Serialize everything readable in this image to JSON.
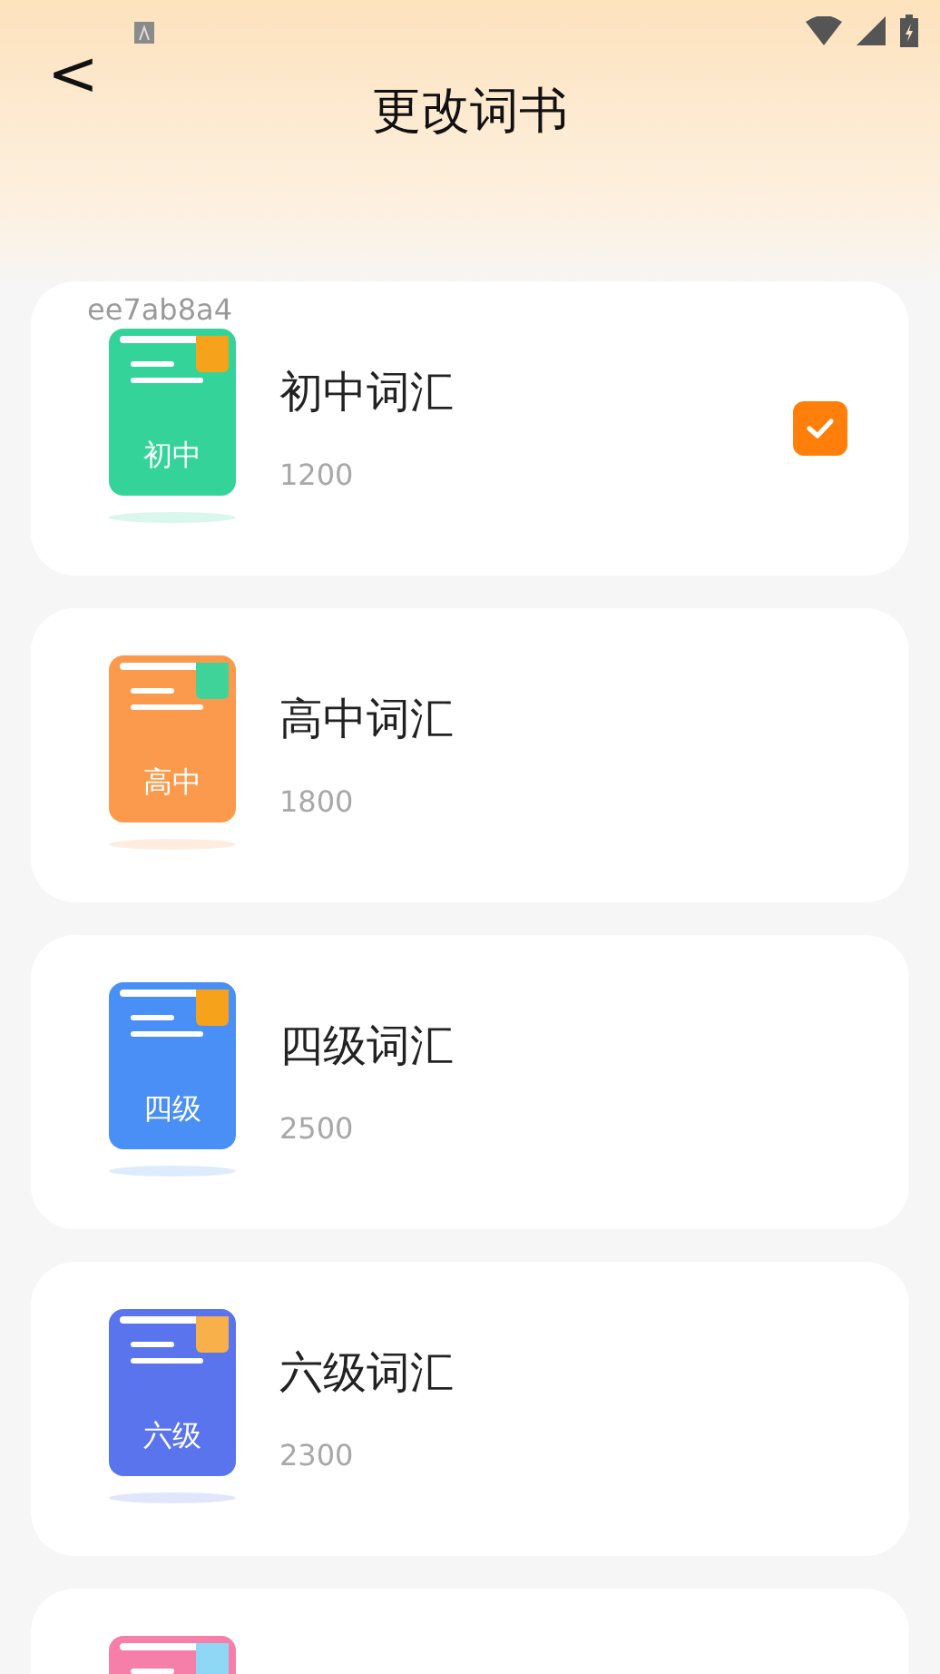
{
  "header": {
    "back": "<",
    "title": "更改词书"
  },
  "debug_label": "ee7ab8a4",
  "books": [
    {
      "title": "初中词汇",
      "count": "1200",
      "cover_label": "初中",
      "color": "#34d39a",
      "bookmark": {
        "color": "#f7a21b"
      },
      "checked": true
    },
    {
      "title": "高中词汇",
      "count": "1800",
      "cover_label": "高中",
      "color": "#fb9a4c",
      "bookmark": {
        "color": "#3fd39a"
      },
      "checked": false
    },
    {
      "title": "四级词汇",
      "count": "2500",
      "cover_label": "四级",
      "color": "#4a8ff5",
      "bookmark": {
        "color": "#f7a21b"
      },
      "checked": false
    },
    {
      "title": "六级词汇",
      "count": "2300",
      "cover_label": "六级",
      "color": "#5a74ee",
      "bookmark": {
        "color": "#f7b04a"
      },
      "checked": false
    },
    {
      "color": "#f57fa8",
      "bookmark": {
        "color": "#8fd8f5"
      },
      "checked": false
    }
  ]
}
